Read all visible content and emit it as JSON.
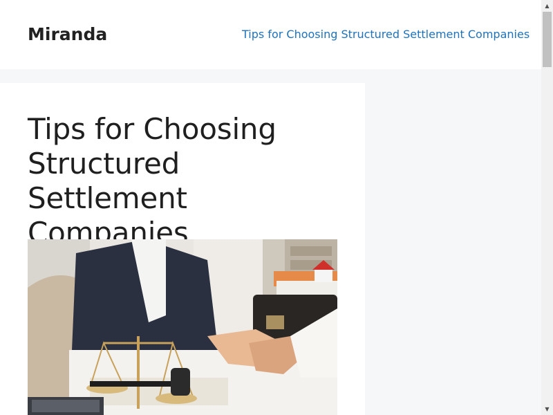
{
  "header": {
    "site_title": "Miranda",
    "nav_link": "Tips for Choosing Structured Settlement Companies"
  },
  "post": {
    "title": "Tips for Choosing Structured Settlement Companies",
    "featured_image": "handshake-with-scales-of-justice-photo"
  },
  "scrollbar": {
    "up_glyph": "▲",
    "down_glyph": "▼"
  }
}
